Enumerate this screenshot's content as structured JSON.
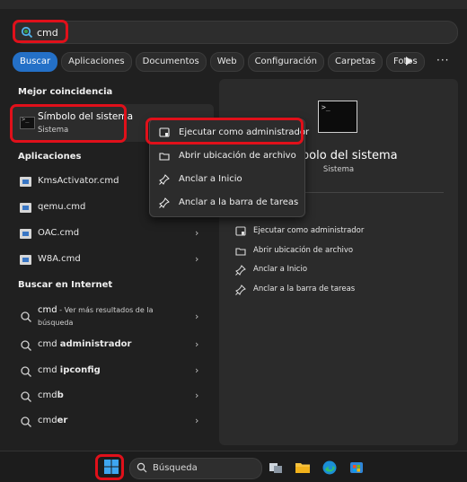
{
  "search": {
    "value": "cmd",
    "placeholder": ""
  },
  "tabs": [
    "Buscar",
    "Aplicaciones",
    "Documentos",
    "Web",
    "Configuración",
    "Carpetas",
    "Fotos"
  ],
  "more_label": "···",
  "best_match": {
    "heading": "Mejor coincidencia",
    "title": "Símbolo del sistema",
    "subtitle": "Sistema"
  },
  "apps": {
    "heading": "Aplicaciones",
    "items": [
      "KmsActivator.cmd",
      "qemu.cmd",
      "OAC.cmd",
      "W8A.cmd"
    ]
  },
  "web": {
    "heading": "Buscar en Internet",
    "first": {
      "term": "cmd",
      "hint": " - Ver más resultados de la",
      "hint2": "búsqueda"
    },
    "items": [
      {
        "prefix": "cmd ",
        "bold": "administrador"
      },
      {
        "prefix": "cmd ",
        "bold": "ipconfig"
      },
      {
        "prefix": "cmd",
        "bold": "b"
      },
      {
        "prefix": "cmd",
        "bold": "er"
      }
    ]
  },
  "context_menu": [
    "Ejecutar como administrador",
    "Abrir ubicación de archivo",
    "Anclar a Inicio",
    "Anclar a la barra de tareas"
  ],
  "detail": {
    "title": "Símbolo del sistema",
    "subtitle": "Sistema",
    "actions": [
      "Ejecutar como administrador",
      "Abrir ubicación de archivo",
      "Anclar a Inicio",
      "Anclar a la barra de tareas"
    ]
  },
  "taskbar": {
    "search_label": "Búsqueda"
  },
  "colors": {
    "accent": "#2470c7",
    "highlight_box": "#e0101a",
    "background": "#202020"
  }
}
